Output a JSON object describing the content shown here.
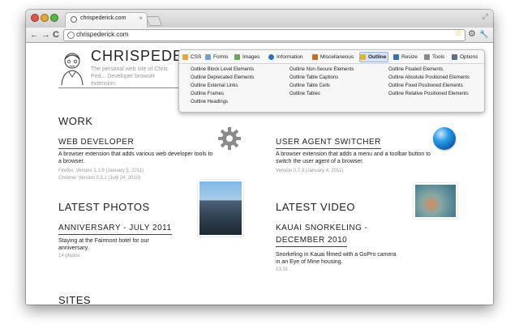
{
  "browser": {
    "tab_title": "chrispederick.com",
    "tab_close": "×",
    "fullscreen_icon": "⤢",
    "url": "chrispederick.com",
    "back_icon": "←",
    "forward_icon": "→",
    "reload_icon": "C",
    "star_icon": "☆",
    "extension_icon": "⚙",
    "wrench_icon": "🔧"
  },
  "site": {
    "title": "CHRISPEDERIC",
    "description": "The personal web site of Chris Ped... Developer browser extension."
  },
  "sections": {
    "work": "WORK",
    "latest_photos": "LATEST PHOTOS",
    "latest_video": "LATEST VIDEO",
    "sites": "SITES"
  },
  "work_items": [
    {
      "title": "WEB DEVELOPER",
      "description": "A browser extension that adds various web developer tools to a browser.",
      "meta1": "Firefox: Version 1.1.9 (January 5, 2011)",
      "meta2": "Chrome: Version 0.3.1 (July 24, 2010)"
    },
    {
      "title": "USER AGENT SWITCHER",
      "description": "A browser extension that adds a menu and a toolbar button to switch the user agent of a browser.",
      "meta1": "Version 0.7.3 (January 4, 2011)"
    }
  ],
  "photo": {
    "title": "ANNIVERSARY - JULY 2011",
    "description": "Staying at the Fairmont hotel for our anniversary.",
    "meta": "14 photos"
  },
  "video": {
    "title_line1": "KAUAI SNORKELING -",
    "title_line2": "DECEMBER 2010",
    "description": "Snorkeling in Kauai filmed with a GoPro camera in an Eye of Mine housing.",
    "meta": "13:31"
  },
  "menu": {
    "tabs": [
      "CSS",
      "Forms",
      "Images",
      "Information",
      "Miscellaneous",
      "Outline",
      "Resize",
      "Tools",
      "Options"
    ],
    "active_tab": "Outline",
    "col1": [
      "Outline Block Level Elements",
      "Outline Deprecated Elements",
      "Outline External Links",
      "Outline Frames",
      "Outline Headings"
    ],
    "col2": [
      "Outline Non-Secure Elements",
      "Outline Table Captions",
      "Outline Table Cells",
      "Outline Tables"
    ],
    "col3": [
      "Outline Floated Elements",
      "Outline Absolute Positioned Elements",
      "Outline Fixed Positioned Elements",
      "Outline Relative Positioned Elements"
    ]
  },
  "colors": {
    "accent_blue": "#2c9be6",
    "close": "#e2534c",
    "minimize": "#e0a934",
    "maximize": "#5cb443"
  }
}
